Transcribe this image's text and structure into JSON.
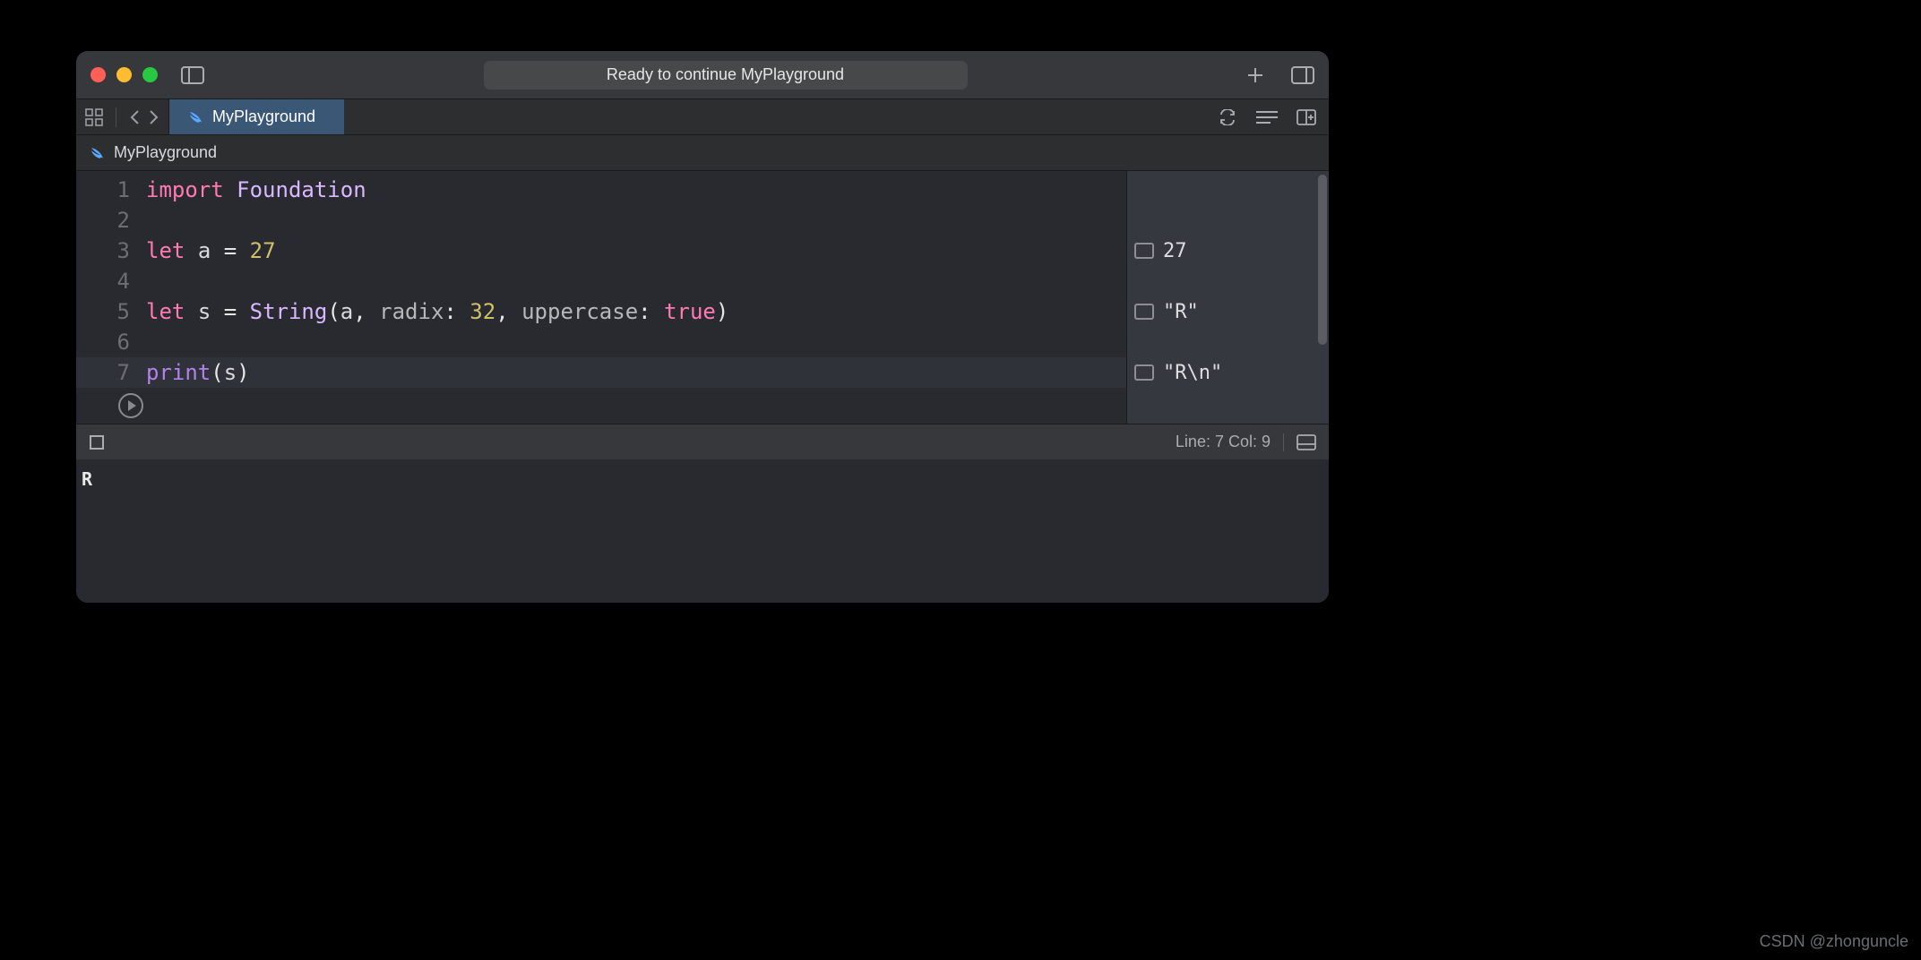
{
  "window": {
    "status": "Ready to continue MyPlayground"
  },
  "tab": {
    "title": "MyPlayground"
  },
  "path": {
    "file": "MyPlayground"
  },
  "code": {
    "lines": [
      {
        "n": "1",
        "tokens": [
          [
            "kw",
            "import"
          ],
          [
            "pun",
            " "
          ],
          [
            "type",
            "Foundation"
          ]
        ]
      },
      {
        "n": "2",
        "tokens": []
      },
      {
        "n": "3",
        "tokens": [
          [
            "kw",
            "let"
          ],
          [
            "pun",
            " "
          ],
          [
            "id",
            "a"
          ],
          [
            "pun",
            " = "
          ],
          [
            "num",
            "27"
          ]
        ]
      },
      {
        "n": "4",
        "tokens": []
      },
      {
        "n": "5",
        "tokens": [
          [
            "kw",
            "let"
          ],
          [
            "pun",
            " "
          ],
          [
            "id",
            "s"
          ],
          [
            "pun",
            " = "
          ],
          [
            "type",
            "String"
          ],
          [
            "pun",
            "("
          ],
          [
            "id",
            "a"
          ],
          [
            "pun",
            ", "
          ],
          [
            "arg",
            "radix"
          ],
          [
            "pun",
            ": "
          ],
          [
            "num",
            "32"
          ],
          [
            "pun",
            ", "
          ],
          [
            "arg",
            "uppercase"
          ],
          [
            "pun",
            ": "
          ],
          [
            "bool",
            "true"
          ],
          [
            "pun",
            ")"
          ]
        ]
      },
      {
        "n": "6",
        "tokens": []
      },
      {
        "n": "7",
        "current": true,
        "tokens": [
          [
            "fn",
            "print"
          ],
          [
            "pun",
            "("
          ],
          [
            "id",
            "s"
          ],
          [
            "pun",
            ")"
          ]
        ]
      }
    ]
  },
  "results": [
    {
      "row": 3,
      "value": "27"
    },
    {
      "row": 5,
      "value": "\"R\""
    },
    {
      "row": 7,
      "value": "\"R\\n\""
    }
  ],
  "debug": {
    "cursor": "Line: 7  Col: 9"
  },
  "console": {
    "output": "R"
  },
  "watermark": "CSDN @zhonguncle"
}
